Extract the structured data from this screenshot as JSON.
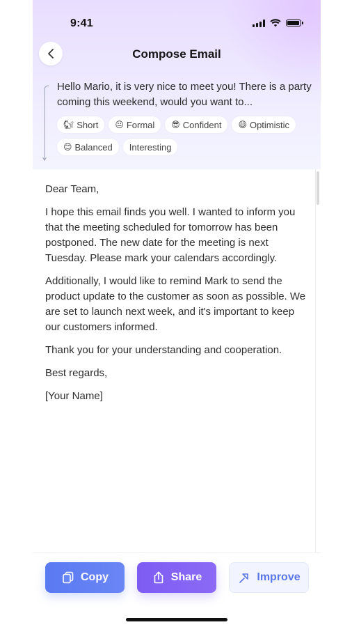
{
  "status_bar": {
    "time": "9:41"
  },
  "header": {
    "title": "Compose Email"
  },
  "prompt": {
    "text": "Hello Mario, it is very nice to meet you! There is a party coming this weekend, would you want to..."
  },
  "tones": [
    {
      "emoji": "🐿",
      "label": "Short"
    },
    {
      "emoji": "😐",
      "label": "Formal"
    },
    {
      "emoji": "😎",
      "label": "Confident"
    },
    {
      "emoji": "😄",
      "label": "Optimistic"
    },
    {
      "emoji": "😊",
      "label": "Balanced"
    },
    {
      "emoji": "",
      "label": "Interesting"
    }
  ],
  "email": {
    "paragraphs": [
      "Dear Team,",
      "I hope this email finds you well. I wanted to inform you that the meeting scheduled for tomorrow has been postponed. The new date for the meeting is next Tuesday. Please mark your calendars accordingly.",
      "Additionally, I would like to remind Mark to send the product update to the customer as soon as possible. We are set to launch next week, and it's important to keep our customers informed.",
      "Thank you for your understanding and cooperation.",
      "Best regards,",
      "[Your Name]"
    ]
  },
  "actions": {
    "copy_label": "Copy",
    "share_label": "Share",
    "improve_label": "Improve"
  },
  "colors": {
    "copy_button": "#5A7AF2",
    "share_button": "#7D5CF3",
    "improve_text": "#5A76E8",
    "header_gradient_top": "#E9DDFF"
  },
  "icons": {
    "back": "chevron-left-icon",
    "copy": "copy-icon",
    "share": "share-icon",
    "improve": "improve-arrow-icon",
    "signal": "signal-icon",
    "wifi": "wifi-icon",
    "battery": "battery-icon"
  }
}
